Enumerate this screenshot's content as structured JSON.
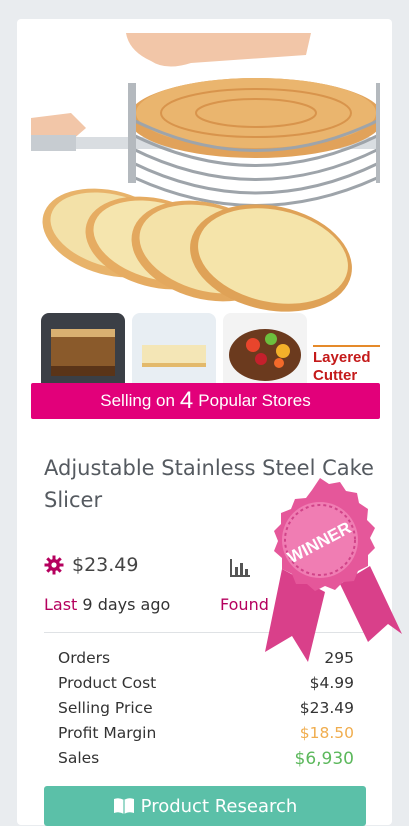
{
  "product": {
    "banner": {
      "prefix": "Selling on",
      "count": "4",
      "suffix": "Popular Stores"
    },
    "image_caption_line1": "Layered",
    "image_caption_line2": "Cutter",
    "title": "Adjustable Stainless Steel Cake Slicer",
    "price": "$23.49",
    "last_label": "Last",
    "last_value": "9 days ago",
    "found_label": "Found",
    "award": "WINNER",
    "stats": [
      {
        "label": "Orders",
        "value": "295"
      },
      {
        "label": "Product Cost",
        "value": "$4.99"
      },
      {
        "label": "Selling Price",
        "value": "$23.49"
      },
      {
        "label": "Profit Margin",
        "value": "$18.50"
      },
      {
        "label": "Sales",
        "value": "$6,930"
      }
    ],
    "button_label": "Product Research"
  },
  "colors": {
    "brand_pink": "#e2007a",
    "button_teal": "#5bc0a8",
    "profit_orange": "#f0ad4e",
    "sales_green": "#5cb85c"
  },
  "icons": {
    "price": "gear-icon",
    "stats": "bar-chart-icon",
    "button": "book-icon"
  }
}
